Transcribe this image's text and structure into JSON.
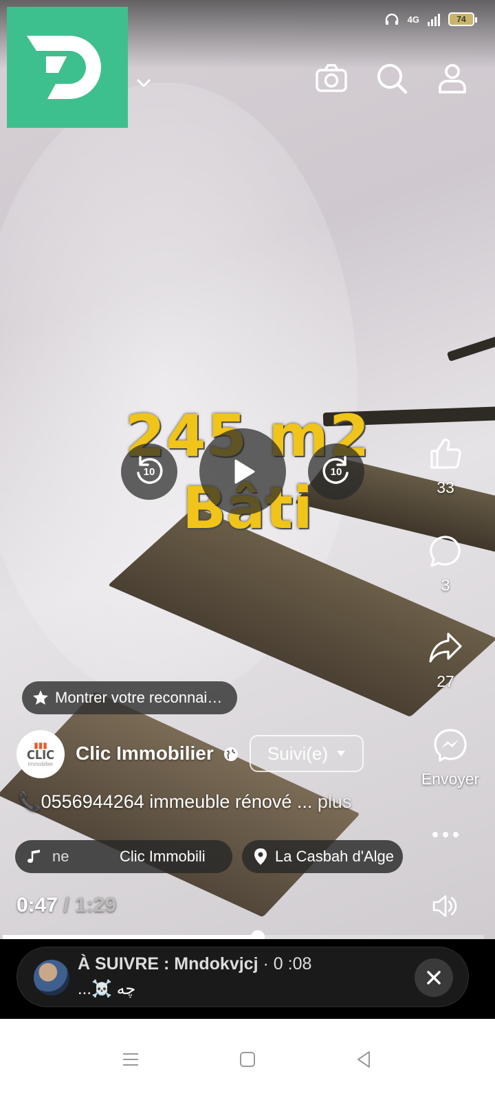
{
  "status_bar": {
    "network": "4G",
    "battery": "74"
  },
  "overlay": {
    "line1": "245 m2",
    "line2": "Bâti"
  },
  "controls": {
    "rewind": "10",
    "forward": "10"
  },
  "actions": {
    "likes": "33",
    "comments": "3",
    "shares": "27",
    "send_label": "Envoyer"
  },
  "reconnaissance": {
    "label": "Montrer votre reconnai…"
  },
  "channel": {
    "name": "Clic Immobilier",
    "avatar_text": "CLIC",
    "avatar_sub": "immobilier",
    "follow_label": "Suivi(e)"
  },
  "caption": {
    "text": "0556944264 immeuble rénové ...",
    "more": "plus"
  },
  "music": {
    "title_partial": "ne",
    "artist": "Clic Immobili"
  },
  "location": {
    "label": "La Casbah d'Alge"
  },
  "playback": {
    "current": "0:47",
    "separator": "/",
    "duration": "1:29",
    "progress": 0.53
  },
  "up_next": {
    "prefix": "À SUIVRE : Mndokvjcj",
    "time": "· 0 :08",
    "title": "...☠️ چه"
  },
  "colors": {
    "brand": "#3ec08e",
    "overlay_text": "#f0c419"
  }
}
